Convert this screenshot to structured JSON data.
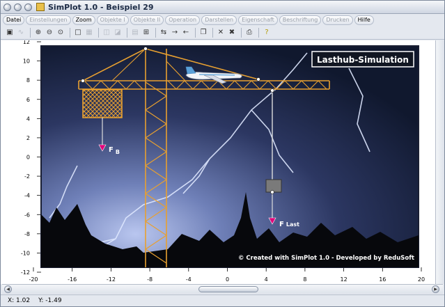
{
  "window": {
    "title": "SimPlot 1.0 - Beispiel 29"
  },
  "menu": {
    "items": [
      {
        "label": "Datei",
        "enabled": true
      },
      {
        "label": "Einstellungen",
        "enabled": false
      },
      {
        "label": "Zoom",
        "enabled": true
      },
      {
        "label": "Objekte I",
        "enabled": false
      },
      {
        "label": "Objekte II",
        "enabled": false
      },
      {
        "label": "Operation",
        "enabled": false
      },
      {
        "label": "Darstellen",
        "enabled": false
      },
      {
        "label": "Eigenschaft",
        "enabled": false
      },
      {
        "label": "Beschriftung",
        "enabled": false
      },
      {
        "label": "Drucken",
        "enabled": false
      },
      {
        "label": "Hilfe",
        "enabled": true
      }
    ]
  },
  "toolbar": {
    "icons": [
      "calculator-icon",
      "curve-icon",
      "zoom-in-icon",
      "zoom-out-icon",
      "zoom-fit-icon",
      "select-icon",
      "grid-icon",
      "layer-icon",
      "layers-icon",
      "image-icon",
      "export-icon",
      "move-icon",
      "arrow-right-icon",
      "arrow-left-icon",
      "copy-icon",
      "cut-icon",
      "delete-icon",
      "print-icon",
      "help-icon"
    ]
  },
  "plot": {
    "x_ticks": [
      "-20",
      "-16",
      "-12",
      "-8",
      "-4",
      "0",
      "4",
      "8",
      "12",
      "16",
      "20"
    ],
    "y_ticks": [
      "12",
      "10",
      "8",
      "6",
      "4",
      "2",
      "0",
      "-2",
      "-4",
      "-6",
      "-8",
      "-10",
      "-12"
    ],
    "title_box": "Lasthub-Simulation",
    "label_fb_main": "F",
    "label_fb_sub": "B",
    "label_flast_main": "F",
    "label_flast_sub": "Last",
    "credit": "© Created with SimPlot 1.0 - Developed by ReduSoft",
    "colors": {
      "crane": "#e8a030",
      "force_arrow": "#e0007a",
      "sky_dark": "#10182e",
      "sky_light": "#6f80b8"
    }
  },
  "status": {
    "x": "X: 1.02",
    "y": "Y: -1.49"
  }
}
